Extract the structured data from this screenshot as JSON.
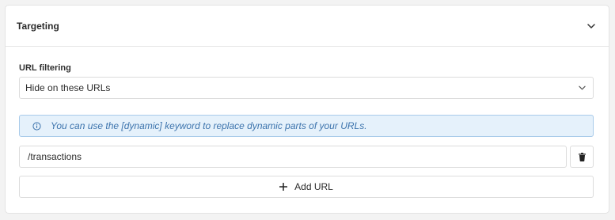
{
  "section": {
    "title": "Targeting",
    "toggle_icon": "chevron-down-icon"
  },
  "url_filtering": {
    "label": "URL filtering",
    "selected": "Hide on these URLs",
    "dropdown_icon": "chevron-down-icon"
  },
  "info": {
    "icon": "info-icon",
    "text": "You can use the [dynamic] keyword to replace dynamic parts of your URLs."
  },
  "urls": [
    {
      "value": "/transactions",
      "delete_icon": "trash-icon"
    }
  ],
  "add_button": {
    "icon": "plus-icon",
    "label": "Add URL"
  },
  "colors": {
    "info_bg": "#e5f1fb",
    "info_border": "#a9cbea",
    "info_text": "#3d74ad"
  }
}
